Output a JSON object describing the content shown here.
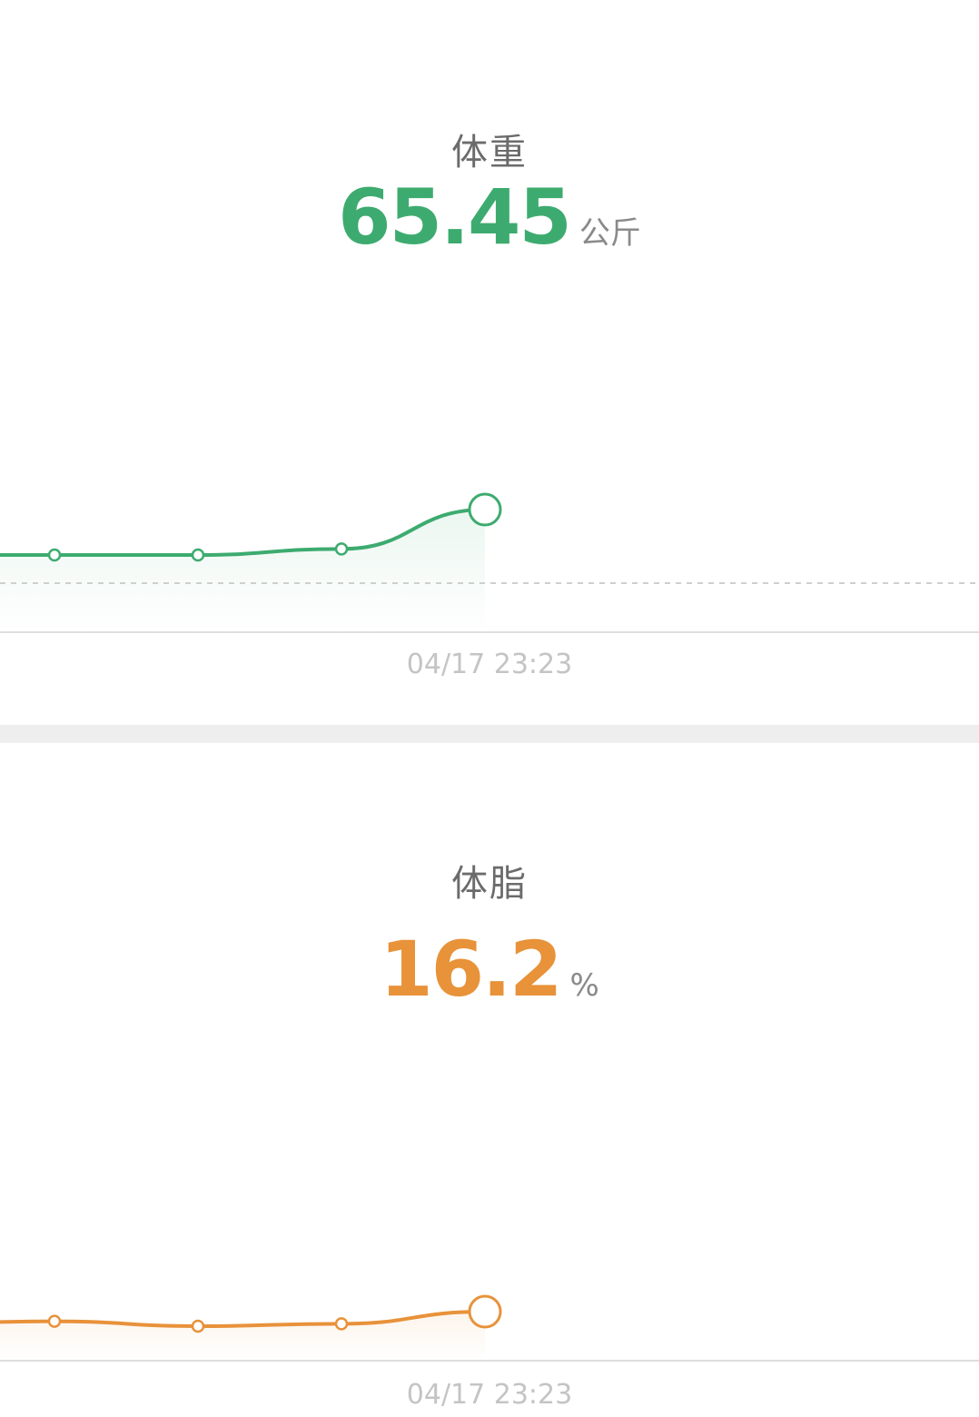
{
  "cards": [
    {
      "title": "体重",
      "value": "65.45",
      "unit": "公斤",
      "color": "#3dab6f",
      "timestamp": "04/17 23:23"
    },
    {
      "title": "体脂",
      "value": "16.2",
      "unit": "%",
      "color": "#e8923a",
      "timestamp": "04/17 23:23"
    }
  ],
  "chart_data": [
    {
      "type": "line",
      "series": [
        {
          "values": [
            65.3,
            65.3,
            65.3,
            65.32,
            65.45
          ]
        }
      ],
      "reference_line": "dashed",
      "grid": false
    },
    {
      "type": "line",
      "series": [
        {
          "values": [
            16.1,
            16.12,
            16.08,
            16.1,
            16.2
          ]
        }
      ],
      "grid": false
    }
  ]
}
